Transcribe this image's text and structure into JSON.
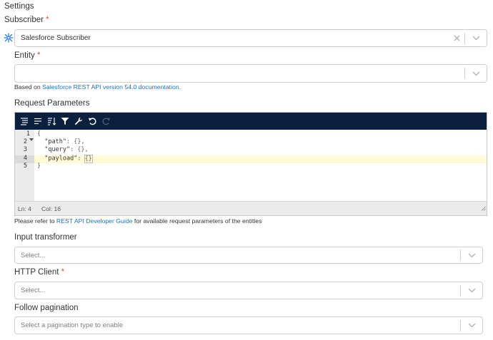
{
  "section_title": "Settings",
  "subscriber": {
    "label": "Subscriber",
    "required_mark": "*",
    "value": "Salesforce Subscriber"
  },
  "entity": {
    "label": "Entity",
    "required_mark": "*",
    "value": "",
    "help_prefix": "Based on ",
    "help_link": "Salesforce REST API version 54.0 documentation",
    "help_suffix": "."
  },
  "request_parameters": {
    "label": "Request Parameters",
    "toolbar_icons": [
      "format-icon",
      "compact-icon",
      "sort-icon",
      "filter-icon",
      "repair-icon",
      "undo-icon",
      "redo-icon"
    ],
    "line_numbers": [
      "1",
      "2",
      "3",
      "4",
      "5"
    ],
    "lines": [
      {
        "text": "{"
      },
      {
        "key": "\"path\"",
        "rest": ": {},"
      },
      {
        "key": "\"query\"",
        "rest": ": {},"
      },
      {
        "key": "\"payload\"",
        "rest": ": ",
        "bracket": "{}"
      },
      {
        "text": "}"
      }
    ],
    "status_ln": "Ln: 4",
    "status_col": "Col: 16",
    "help_prefix": "Please refer to ",
    "help_link": "REST API Developer Guide",
    "help_suffix": " for available request parameters of the entities"
  },
  "input_transformer": {
    "label": "Input transformer",
    "placeholder": "Select..."
  },
  "http_client": {
    "label": "HTTP Client",
    "required_mark": "*",
    "placeholder": "Select..."
  },
  "follow_pagination": {
    "label": "Follow pagination",
    "placeholder": "Select a pagination type to enable"
  },
  "colors": {
    "toolbar_bg": "#0b1f3f",
    "link": "#1a73c8",
    "required": "#d9534f",
    "active_line": "#fffbd6",
    "subscriber_icon": "#2a7de1"
  }
}
